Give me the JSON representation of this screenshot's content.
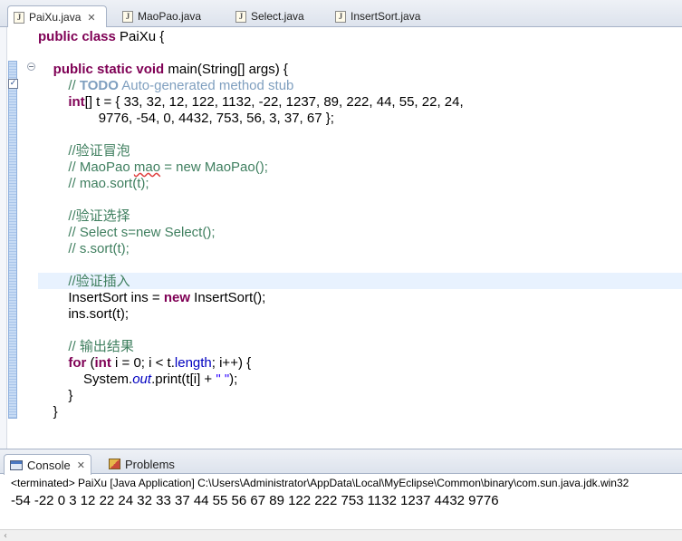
{
  "editor_tabs": [
    {
      "label": "PaiXu.java",
      "active": true,
      "close": "✕"
    },
    {
      "label": "MaoPao.java",
      "active": false
    },
    {
      "label": "Select.java",
      "active": false
    },
    {
      "label": "InsertSort.java",
      "active": false
    }
  ],
  "code": {
    "l1": {
      "kw": "public class",
      "rest": " PaiXu {"
    },
    "l3": {
      "kw": "public static void",
      "rest": " main(String[] args) {"
    },
    "l4": {
      "prefix": "// ",
      "todo": "TODO",
      "text": " Auto-generated method stub"
    },
    "l5": {
      "kw": "int",
      "rest": "[] t = { 33, 32, 12, 122, 1132, -22, 1237, 89, 222, 44, 55, 22, 24,"
    },
    "l6": "9776, -54, 0, 4432, 753, 56, 3, 37, 67 };",
    "l8": "//验证冒泡",
    "l9": {
      "a": "// MaoPao ",
      "b": "mao",
      "c": " = new MaoPao();"
    },
    "l10": "// mao.sort(t);",
    "l12": "//验证选择",
    "l13": "// Select s=new Select();",
    "l14": "// s.sort(t);",
    "l16": "//验证插入",
    "l17": {
      "a": "InsertSort ins = ",
      "kw": "new",
      "b": " InsertSort();"
    },
    "l18": "ins.sort(t);",
    "l20": "// 输出结果",
    "l21": {
      "kw1": "for",
      "a": " (",
      "kw2": "int",
      "b": " i = 0; i < t.",
      "fld": "length",
      "c": "; i++) {"
    },
    "l22": {
      "a": "System.",
      "out": "out",
      "b": ".print(t[i] + ",
      "str": "\" \"",
      "c": ");"
    },
    "l23": "}",
    "l24": "}"
  },
  "console": {
    "tabs": [
      {
        "label": "Console",
        "active": true,
        "close": "✕"
      },
      {
        "label": "Problems",
        "active": false
      }
    ],
    "status": "<terminated> PaiXu [Java Application] C:\\Users\\Administrator\\AppData\\Local\\MyEclipse\\Common\\binary\\com.sun.java.jdk.win32",
    "output": "-54 -22 0 3 12 22 24 32 33 37 44 55 56 67 89 122 222 753 1132 1237 4432 9776",
    "scroll_left": "‹"
  },
  "colors": {
    "keyword": "#7f0055",
    "comment": "#3f7f5f",
    "todo": "#7f9fbf",
    "field": "#0000c0",
    "string": "#2a00ff"
  }
}
